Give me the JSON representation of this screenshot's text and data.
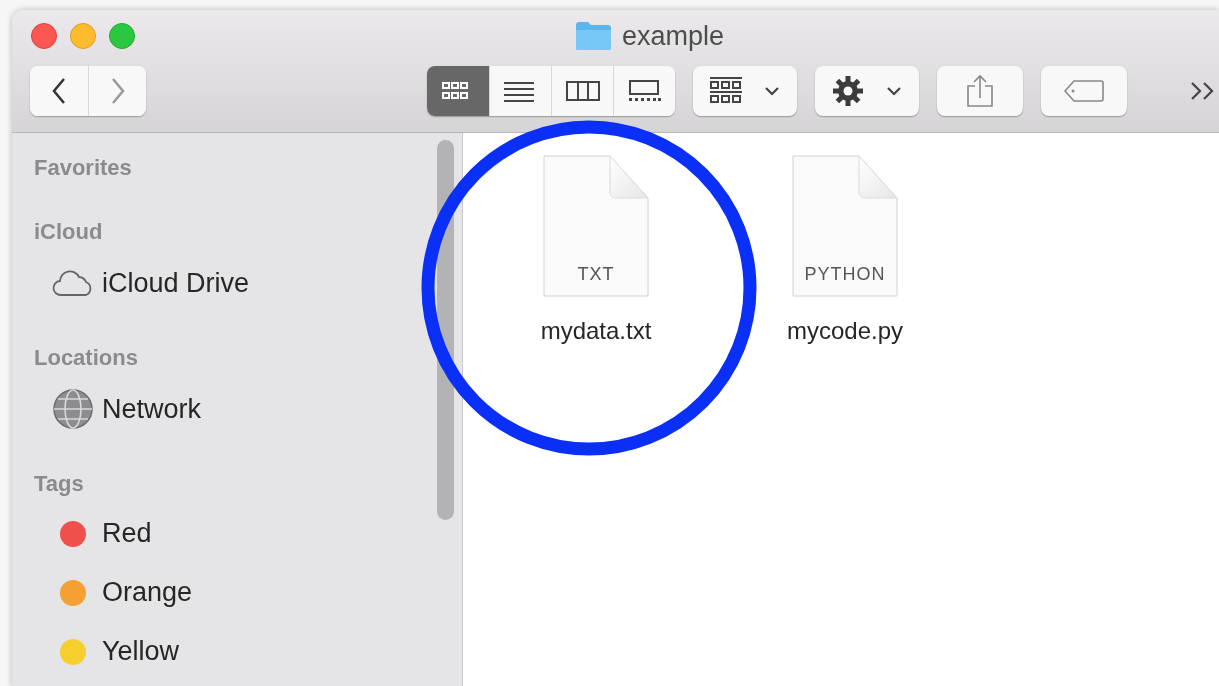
{
  "window": {
    "title": "example"
  },
  "toolbar": {
    "view_modes": [
      {
        "kind": "icons",
        "selected": true
      },
      {
        "kind": "list",
        "selected": false
      },
      {
        "kind": "columns",
        "selected": false
      },
      {
        "kind": "gallery",
        "selected": false
      }
    ]
  },
  "sidebar": {
    "sections": [
      {
        "title": "Favorites"
      },
      {
        "title": "iCloud",
        "items": [
          {
            "label": "iCloud Drive",
            "kind": "cloud"
          }
        ]
      },
      {
        "title": "Locations",
        "items": [
          {
            "label": "Network",
            "kind": "network"
          }
        ]
      },
      {
        "title": "Tags",
        "items": [
          {
            "label": "Red",
            "kind": "tag",
            "color": "#f0504c"
          },
          {
            "label": "Orange",
            "kind": "tag",
            "color": "#f5a032"
          },
          {
            "label": "Yellow",
            "kind": "tag",
            "color": "#f6cf2f"
          }
        ]
      }
    ]
  },
  "files": [
    {
      "name": "mydata.txt",
      "type_label": "TXT",
      "highlighted": true
    },
    {
      "name": "mycode.py",
      "type_label": "PYTHON",
      "highlighted": false
    }
  ]
}
